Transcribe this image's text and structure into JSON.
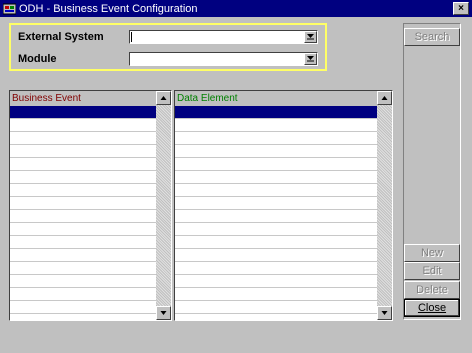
{
  "window": {
    "title": "ODH - Business Event Configuration",
    "close_label": "×"
  },
  "filters": {
    "external_system_label": "External System",
    "external_system_value": "",
    "module_label": "Module",
    "module_value": ""
  },
  "buttons": {
    "search": "Search",
    "new": "New",
    "edit": "Edit",
    "delete": "Delete",
    "close": "Close"
  },
  "business_event_grid": {
    "header": "Business Event",
    "header_color": "#800000",
    "rows": [
      "",
      "",
      "",
      "",
      "",
      "",
      "",
      "",
      "",
      "",
      "",
      "",
      "",
      "",
      "",
      ""
    ]
  },
  "data_element_grid": {
    "header": "Data Element",
    "header_color": "#008000",
    "rows": [
      "",
      "",
      "",
      "",
      "",
      "",
      "",
      "",
      "",
      "",
      "",
      "",
      "",
      "",
      "",
      ""
    ]
  },
  "colors": {
    "titlebar": "#000080",
    "highlight_border": "#ffff66",
    "selection": "#000080"
  }
}
